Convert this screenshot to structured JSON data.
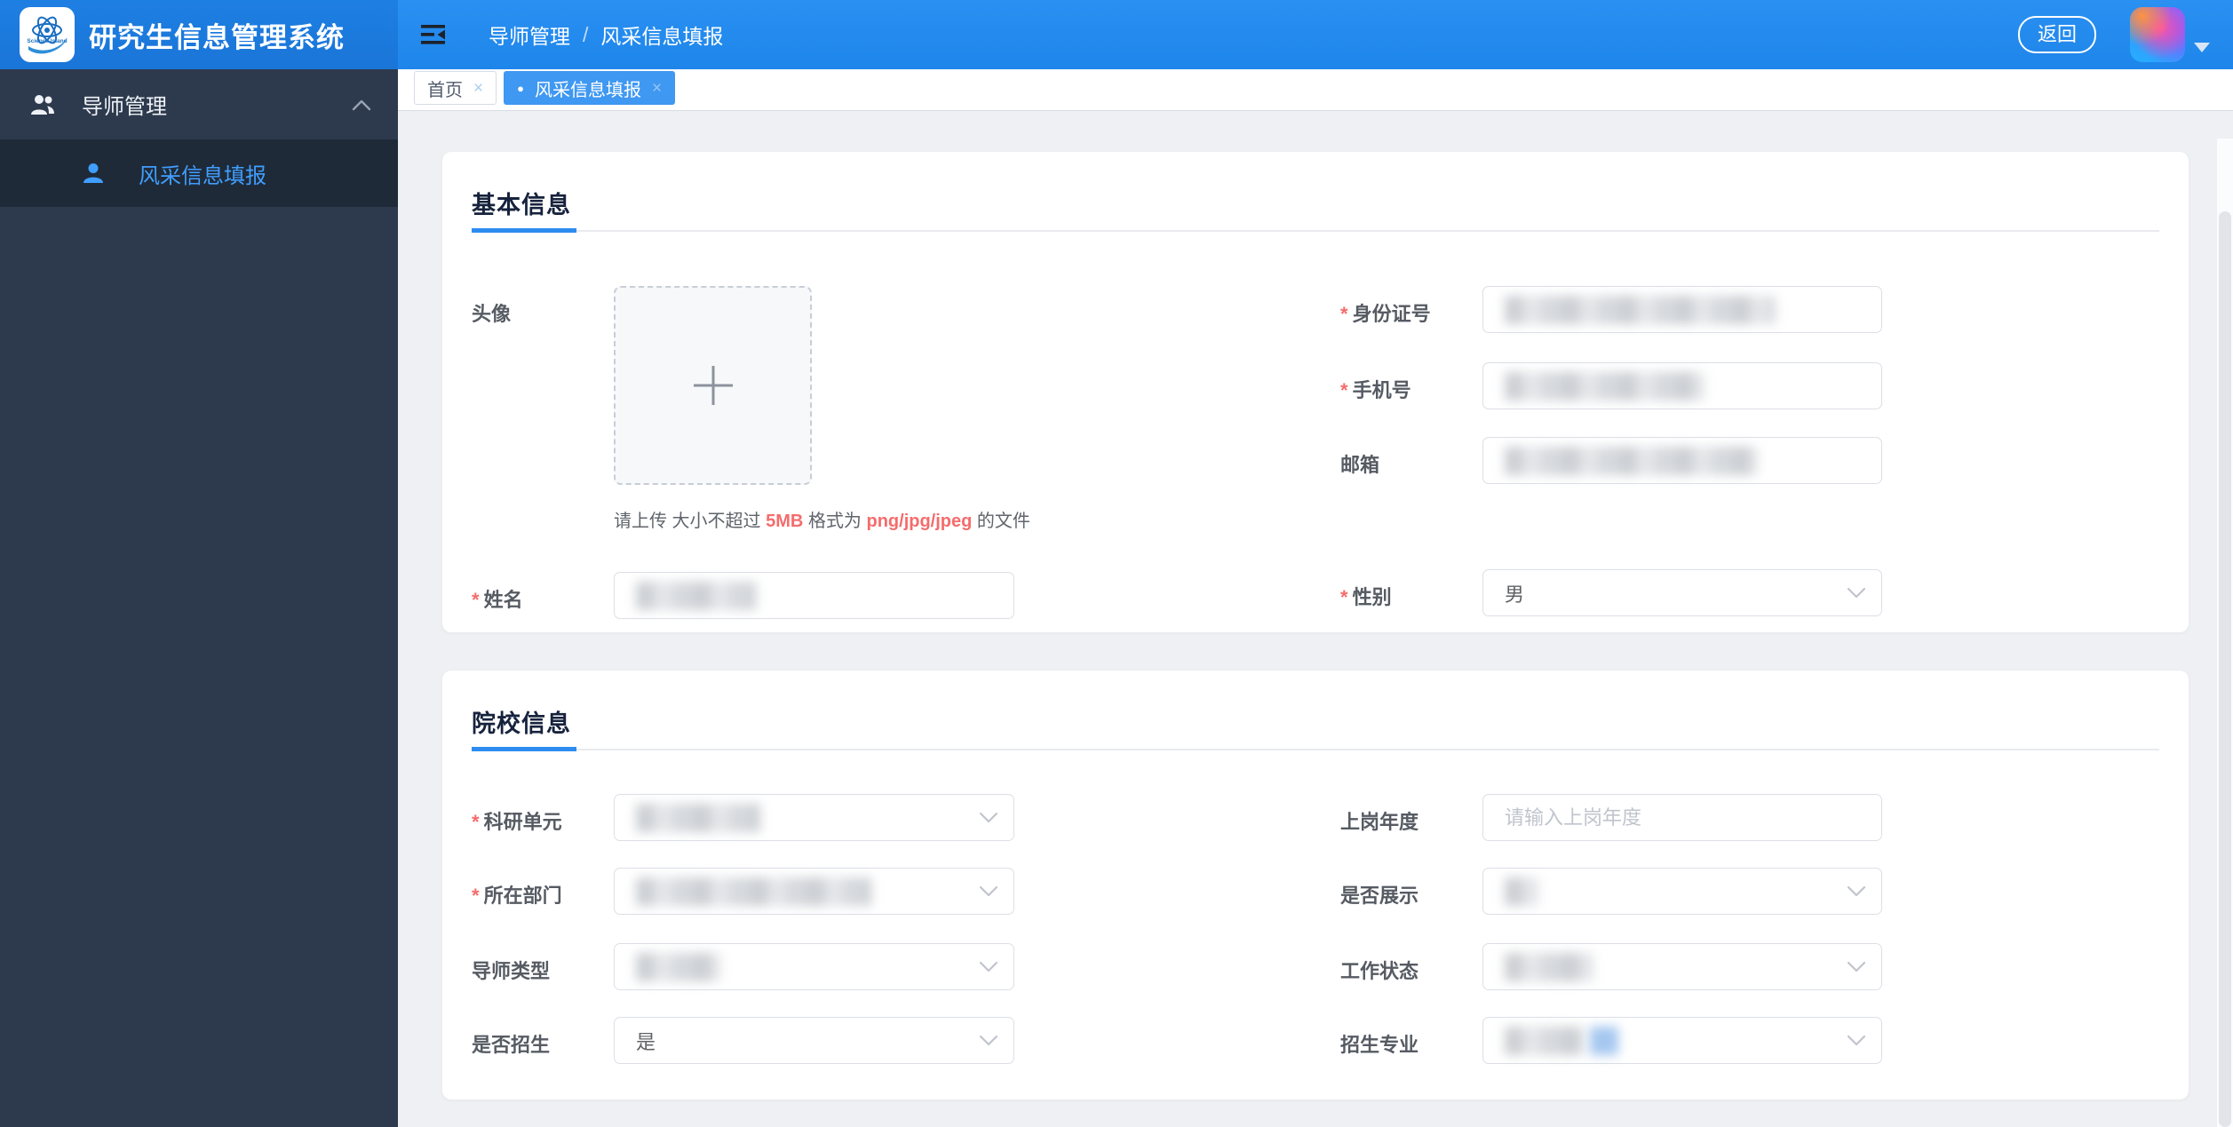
{
  "app": {
    "title": "研究生信息管理系统",
    "logo_text": "Science Island"
  },
  "header": {
    "breadcrumb_1": "导师管理",
    "separator": "/",
    "breadcrumb_2": "风采信息填报",
    "back_button": "返回"
  },
  "sidebar": {
    "group_label": "导师管理",
    "item_label": "风采信息填报"
  },
  "tabs": {
    "home_label": "首页",
    "active_label": "风采信息填报",
    "close_glyph": "×",
    "active_dot": "●"
  },
  "required_mark": "*",
  "basic": {
    "title": "基本信息",
    "avatar_label": "头像",
    "upload_hint_p1": "请上传 大小不超过",
    "upload_hint_size": "5MB",
    "upload_hint_p2": "格式为",
    "upload_hint_formats": "png/jpg/jpeg",
    "upload_hint_p3": "的文件",
    "name_label": "姓名",
    "id_label": "身份证号",
    "phone_label": "手机号",
    "email_label": "邮箱",
    "gender_label": "性别",
    "gender_value": "男"
  },
  "school": {
    "title": "院校信息",
    "unit_label": "科研单元",
    "dept_label": "所在部门",
    "type_label": "导师类型",
    "recruit_label": "是否招生",
    "recruit_value": "是",
    "year_label": "上岗年度",
    "year_placeholder": "请输入上岗年度",
    "show_label": "是否展示",
    "work_label": "工作状态",
    "major_label": "招生专业"
  },
  "icons": {
    "menu_fold": "menu-fold",
    "user_group": "user-group",
    "user": "user",
    "chevron_up": "chevron-up",
    "chevron_down": "chevron-down",
    "plus": "plus",
    "caret_down": "caret-down",
    "close": "close"
  },
  "colors": {
    "accent": "#2d8cf0",
    "header_blue": "#2189ee",
    "brand_blue": "#1b78dc",
    "active_tab": "#3f98f1",
    "sidebar_dark": "#2d3a4d",
    "sidebar_submenu": "#1f2a38",
    "required_red": "#f56c6c",
    "page_bg": "#eef0f3"
  }
}
